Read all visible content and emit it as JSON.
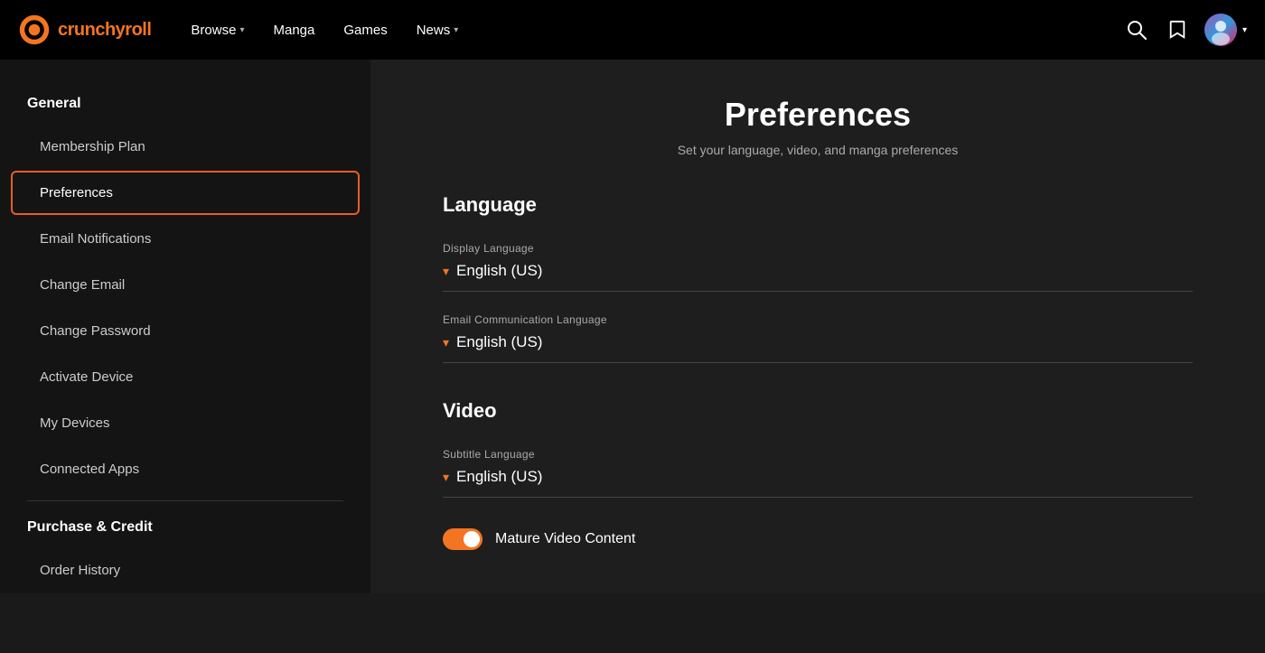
{
  "header": {
    "logo_text": "crunchyroll",
    "nav_items": [
      {
        "label": "Browse",
        "has_dropdown": true
      },
      {
        "label": "Manga",
        "has_dropdown": false
      },
      {
        "label": "Games",
        "has_dropdown": false
      },
      {
        "label": "News",
        "has_dropdown": true
      }
    ],
    "icons": {
      "search": "🔍",
      "bookmark": "🔖",
      "chevron": "▾"
    }
  },
  "sidebar": {
    "section1_title": "General",
    "items": [
      {
        "label": "Membership Plan",
        "active": false
      },
      {
        "label": "Preferences",
        "active": true
      },
      {
        "label": "Email Notifications",
        "active": false
      },
      {
        "label": "Change Email",
        "active": false
      },
      {
        "label": "Change Password",
        "active": false
      },
      {
        "label": "Activate Device",
        "active": false
      },
      {
        "label": "My Devices",
        "active": false
      },
      {
        "label": "Connected Apps",
        "active": false
      }
    ],
    "section2_title": "Purchase & Credit",
    "items2": [
      {
        "label": "Order History",
        "active": false
      }
    ]
  },
  "content": {
    "title": "Preferences",
    "subtitle": "Set your language, video, and manga preferences",
    "sections": [
      {
        "heading": "Language",
        "fields": [
          {
            "label": "Display Language",
            "value": "English (US)"
          },
          {
            "label": "Email Communication Language",
            "value": "English (US)"
          }
        ]
      },
      {
        "heading": "Video",
        "fields": [
          {
            "label": "Subtitle Language",
            "value": "English (US)"
          }
        ],
        "toggle": {
          "label": "Mature Video Content",
          "enabled": true
        }
      }
    ]
  }
}
